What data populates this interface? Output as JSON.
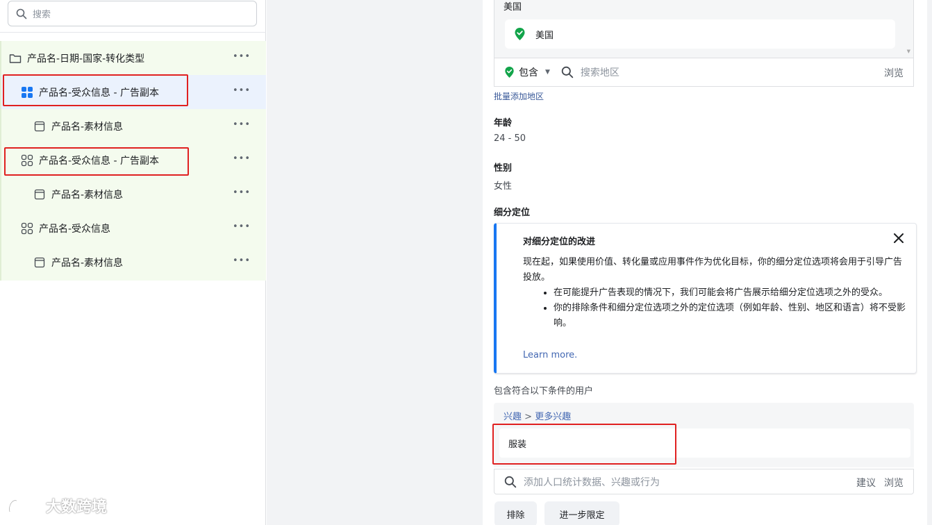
{
  "sidebar": {
    "search_placeholder": "搜索",
    "items": [
      {
        "label": "产品名-日期-国家-转化类型",
        "icon": "folder-icon",
        "more": "•••"
      },
      {
        "label": "产品名-受众信息 - 广告副本",
        "icon": "adset-filled-icon",
        "more": "•••"
      },
      {
        "label": "产品名-素材信息",
        "icon": "ad-icon",
        "more": "•••"
      },
      {
        "label": "产品名-受众信息 - 广告副本",
        "icon": "adset-outline-icon",
        "more": "•••"
      },
      {
        "label": "产品名-素材信息",
        "icon": "ad-icon",
        "more": "•••"
      },
      {
        "label": "产品名-受众信息",
        "icon": "adset-outline-icon",
        "more": "•••"
      },
      {
        "label": "产品名-素材信息",
        "icon": "ad-icon",
        "more": "•••"
      }
    ]
  },
  "watermark": "大数跨境",
  "location": {
    "label": "美国",
    "chip": "美国",
    "include": "包含",
    "search_placeholder": "搜索地区",
    "browse": "浏览",
    "bulk_add": "批量添加地区"
  },
  "age": {
    "title": "年龄",
    "value": "24 - 50"
  },
  "gender": {
    "title": "性别",
    "value": "女性"
  },
  "detailed": {
    "title": "细分定位"
  },
  "notice": {
    "title": "对细分定位的改进",
    "body": "现在起，如果使用价值、转化量或应用事件作为优化目标，你的细分定位选项将会用于引导广告投放。",
    "bullets": [
      "在可能提升广告表现的情况下，我们可能会将广告展示给细分定位选项之外的受众。",
      "你的排除条件和细分定位选项之外的定位选项（例如年龄、性别、地区和语言）将不受影响。"
    ],
    "link": "Learn more."
  },
  "interests": {
    "include_label": "包含符合以下条件的用户",
    "crumb1": "兴趣",
    "crumb_sep": ">",
    "crumb2": "更多兴趣",
    "chip": "服装",
    "search_placeholder": "添加人口统计数据、兴趣或行为",
    "suggest": "建议",
    "browse": "浏览"
  },
  "buttons": {
    "exclude": "排除",
    "narrow": "进一步限定"
  },
  "colors": {
    "accent": "#1877f2",
    "green": "#12a44a",
    "highlight": "#e02020",
    "tree_bg": "#f4fbee"
  }
}
